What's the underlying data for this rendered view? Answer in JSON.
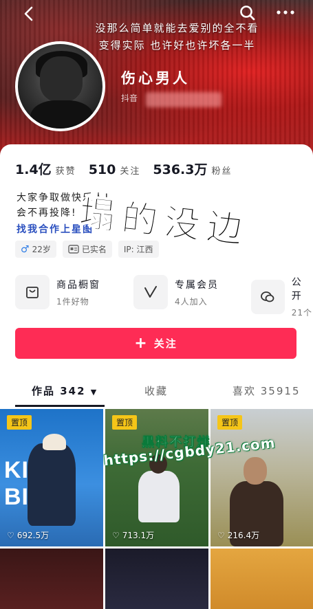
{
  "header": {
    "signature_line1": "没那么简单就能去爱别的全不看",
    "signature_line2": "变得实际 也许好也许坏各一半",
    "nickname": "伤心男人",
    "uid_label": "抖音"
  },
  "stats": [
    {
      "value": "1.4亿",
      "label": "获赞"
    },
    {
      "value": "510",
      "label": "关注"
    },
    {
      "value": "536.3万",
      "label": "粉丝"
    }
  ],
  "bio": {
    "line1": "大家争取做快乐人!",
    "line2": "会不再投降!",
    "line3": "找我合作上星图"
  },
  "overlay_text": "塌的没边",
  "tags": [
    {
      "icon": "male-icon",
      "symbol": "♂",
      "label": "22岁"
    },
    {
      "icon": "id-card-icon",
      "symbol": "",
      "label": "已实名"
    },
    {
      "icon": "",
      "symbol": "",
      "label": "IP: 江西"
    }
  ],
  "services": [
    {
      "icon": "shop-bag-icon",
      "title": "商品橱窗",
      "sub": "1件好物"
    },
    {
      "icon": "v-badge-icon",
      "title": "专属会员",
      "sub": "4人加入"
    },
    {
      "icon": "chat-bubbles-icon",
      "title": "公开",
      "sub": "21个"
    }
  ],
  "follow_button": {
    "label": "关注"
  },
  "tabs": [
    {
      "label": "作品 342",
      "active": true
    },
    {
      "label": "收藏",
      "active": false
    },
    {
      "label": "喜欢 35915",
      "active": false
    }
  ],
  "videos": [
    {
      "pinned": "置顶",
      "likes": "692.5万",
      "title_art": "KILL BILL"
    },
    {
      "pinned": "置顶",
      "likes": "713.1万"
    },
    {
      "pinned": "置顶",
      "likes": "216.4万"
    }
  ],
  "watermark": {
    "line1": "黑料不打烊",
    "line2": "https://cgbdy21.com"
  },
  "colors": {
    "accent": "#fe2c55",
    "pin": "#f5c518",
    "link": "#2a4fbf"
  }
}
